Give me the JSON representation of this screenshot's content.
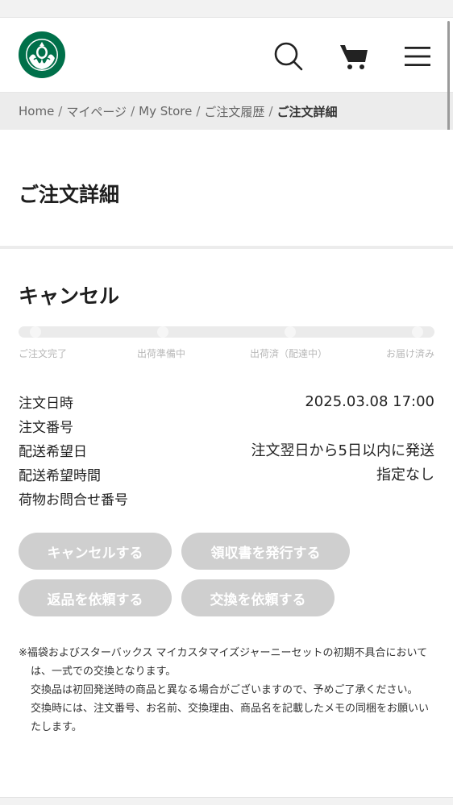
{
  "header": {
    "logo_icon": "starbucks-siren-logo",
    "search_icon": "search-icon",
    "cart_icon": "cart-icon",
    "menu_icon": "hamburger-menu-icon"
  },
  "breadcrumb": {
    "items": [
      "Home",
      "マイページ",
      "My Store",
      "ご注文履歴"
    ],
    "current": "ご注文詳細",
    "separator": "/"
  },
  "page": {
    "title": "ご注文詳細"
  },
  "order": {
    "status": "キャンセル",
    "progress_steps": [
      "ご注文完了",
      "出荷準備中",
      "出荷済（配達中）",
      "お届け済み"
    ],
    "fields": [
      {
        "label": "注文日時",
        "value": "2025.03.08 17:00"
      },
      {
        "label": "注文番号",
        "value": ""
      },
      {
        "label": "配送希望日",
        "value": "注文翌日から5日以内に発送"
      },
      {
        "label": "配送希望時間",
        "value": "指定なし"
      },
      {
        "label": "荷物お問合せ番号",
        "value": ""
      }
    ]
  },
  "actions": {
    "cancel": "キャンセルする",
    "receipt": "領収書を発行する",
    "return": "返品を依頼する",
    "exchange": "交換を依頼する"
  },
  "notes": {
    "line1": "※福袋およびスターバックス マイカスタマイズジャーニーセットの初期不具合においては、一式での交換となります。",
    "line2": "交換品は初回発送時の商品と異なる場合がございますので、予めご了承ください。",
    "line3": "交換時には、注文番号、お名前、交換理由、商品名を記載したメモの同梱をお願いいたします。"
  }
}
